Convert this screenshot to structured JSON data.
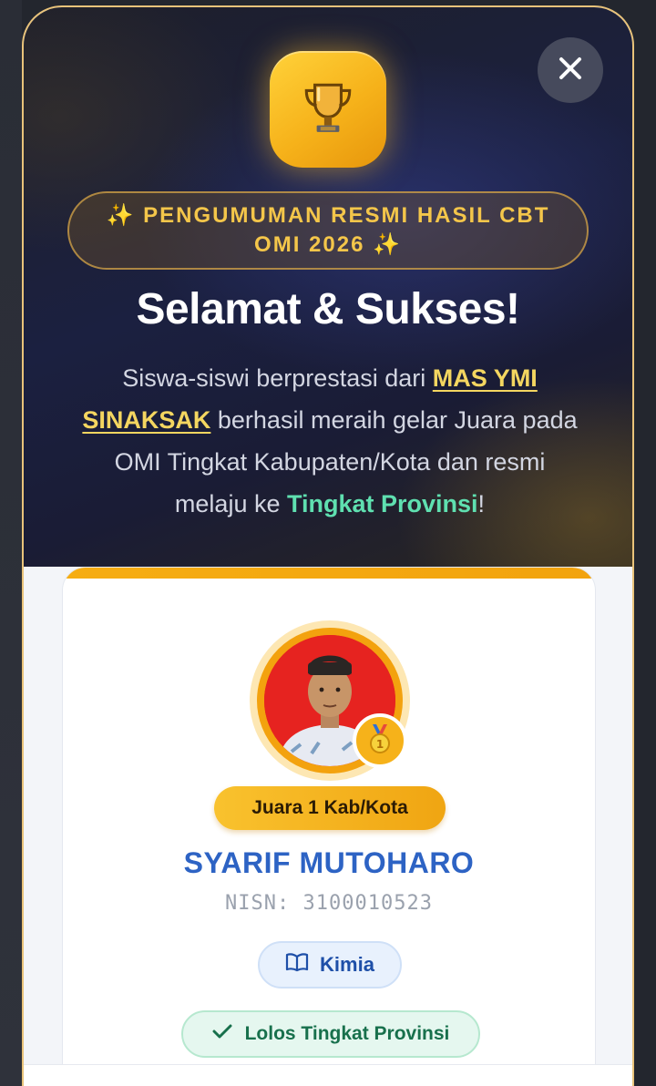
{
  "modal": {
    "close_icon": "close-icon",
    "trophy_icon": "trophy-icon",
    "announcement": "✨ PENGUMUMAN RESMI HASIL CBT OMI 2026 ✨",
    "title": "Selamat & Sukses!",
    "description": {
      "part1": "Siswa-siswi berprestasi dari ",
      "school": "MAS YMI SINAKSAK",
      "part2": " berhasil meraih gelar Juara pada OMI Tingkat Kabupaten/Kota dan resmi melaju ke ",
      "level": "Tingkat Provinsi",
      "part3": "!"
    }
  },
  "student": {
    "medal_icon": "gold-medal-icon",
    "rank": "Juara 1 Kab/Kota",
    "name": "SYARIF MUTOHARO",
    "nisn": "NISN: 3100010523",
    "subject_icon": "book-icon",
    "subject": "Kimia",
    "status_icon": "check-icon",
    "status": "Lolos Tingkat Provinsi"
  },
  "colors": {
    "accent_gold": "#f6b21a",
    "name_blue": "#2d63c4",
    "success_green": "#17704c",
    "hero_bg": "#1b2040"
  }
}
